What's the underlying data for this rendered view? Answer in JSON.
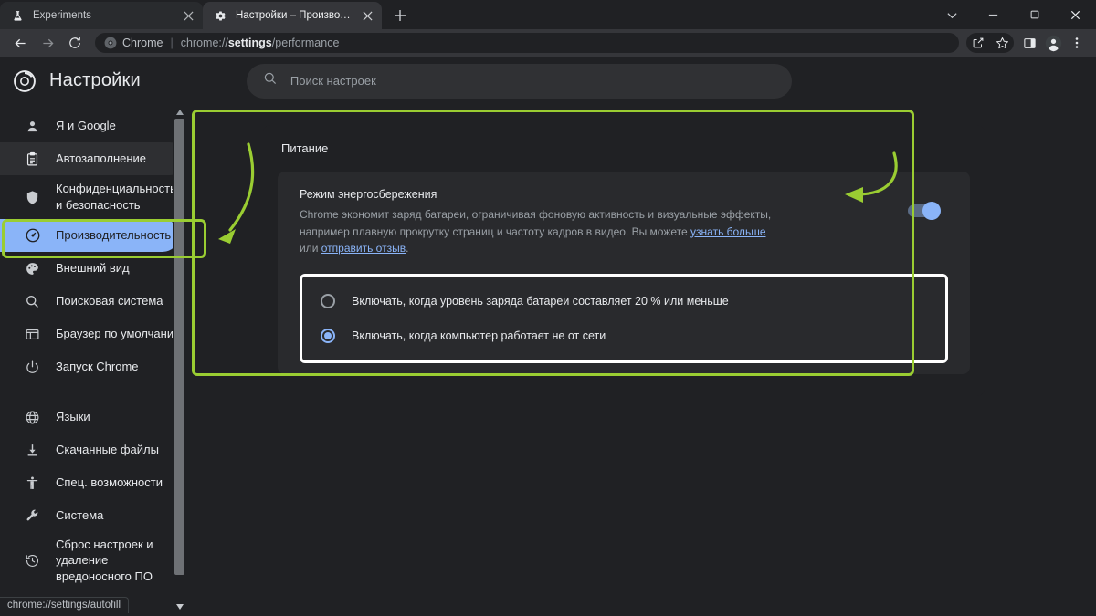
{
  "window": {
    "controls": [
      {
        "name": "tab-search-button",
        "glyph": "⌄"
      },
      {
        "name": "minimize-button",
        "glyph": "─"
      },
      {
        "name": "maximize-button",
        "glyph": "☐"
      },
      {
        "name": "close-button",
        "glyph": "✕"
      }
    ]
  },
  "tabs": [
    {
      "title": "Experiments",
      "favicon": "flask-icon",
      "active": false
    },
    {
      "title": "Настройки – Производительность",
      "favicon": "gear-icon",
      "active": true
    }
  ],
  "newtab_label": "+",
  "toolbar": {
    "back_icon": "back-arrow-icon",
    "forward_icon": "forward-arrow-icon",
    "reload_icon": "reload-icon",
    "omnibox": {
      "chip_label": "Chrome",
      "url_scheme": "chrome://",
      "url_bold": "settings",
      "url_rest": "/performance",
      "full_url": "chrome://settings/performance"
    },
    "right_icons": [
      {
        "name": "share-icon"
      },
      {
        "name": "bookmark-star-icon"
      },
      {
        "name": "side-panel-icon"
      },
      {
        "name": "profile-avatar"
      },
      {
        "name": "chrome-menu-icon"
      }
    ]
  },
  "header": {
    "logo": "chrome-logo",
    "title": "Настройки",
    "search_placeholder": "Поиск настроек",
    "search_value": "",
    "search_icon": "search-icon"
  },
  "sidebar": {
    "items": [
      {
        "label": "Я и Google",
        "icon": "person-icon",
        "state": "normal"
      },
      {
        "label": "Автозаполнение",
        "icon": "clipboard-icon",
        "state": "hovered"
      },
      {
        "label": "Конфиденциальность и безопасность",
        "icon": "shield-icon",
        "state": "normal"
      },
      {
        "label": "Производительность",
        "icon": "speedometer-icon",
        "state": "selected"
      },
      {
        "label": "Внешний вид",
        "icon": "palette-icon",
        "state": "normal"
      },
      {
        "label": "Поисковая система",
        "icon": "search-icon",
        "state": "normal"
      },
      {
        "label": "Браузер по умолчанию",
        "icon": "browser-window-icon",
        "state": "normal"
      },
      {
        "label": "Запуск Chrome",
        "icon": "power-icon",
        "state": "normal"
      }
    ],
    "items2": [
      {
        "label": "Языки",
        "icon": "globe-icon"
      },
      {
        "label": "Скачанные файлы",
        "icon": "download-icon"
      },
      {
        "label": "Спец. возможности",
        "icon": "accessibility-icon"
      },
      {
        "label": "Система",
        "icon": "wrench-icon"
      },
      {
        "label": "Сброс настроек и удаление вредоносного ПО",
        "icon": "restore-icon"
      }
    ]
  },
  "content": {
    "section_title": "Питание",
    "setting": {
      "name": "Режим энергосбережения",
      "desc_part1": "Chrome экономит заряд батареи, ограничивая фоновую активность и визуальные эффекты, например плавную прокрутку страниц и частоту кадров в видео. Вы можете ",
      "link_learn_more": "узнать больше",
      "desc_part2": " или ",
      "link_feedback": "отправить отзыв",
      "desc_part3": ".",
      "toggle_on": true
    },
    "radio_options": [
      {
        "label": "Включать, когда уровень заряда батареи составляет 20 % или меньше",
        "selected": false
      },
      {
        "label": "Включать, когда компьютер работает не от сети",
        "selected": true
      }
    ]
  },
  "statusbar": {
    "url": "chrome://settings/autofill"
  },
  "colors": {
    "annotation_green": "#9acd32",
    "accent_blue": "#8ab4f8",
    "window_bg": "#202124",
    "toolbar_bg": "#35363a",
    "card_bg": "#292a2d",
    "highlight_white": "#ffffff"
  }
}
